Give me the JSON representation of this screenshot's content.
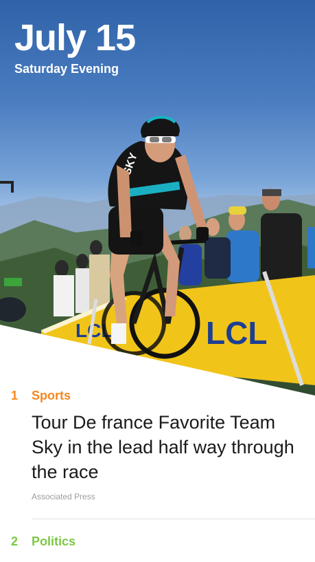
{
  "header": {
    "date": "July 15",
    "subtitle": "Saturday Evening"
  },
  "stories": [
    {
      "number": "1",
      "category": "Sports",
      "category_color": "#f4871f",
      "headline": "Tour De france Favorite Team Sky in the lead half way through the race",
      "source": "Associated Press"
    },
    {
      "number": "2",
      "category": "Politics",
      "category_color": "#7ac943"
    }
  ],
  "hero_image": {
    "banner_text": "LCL",
    "jersey_text": "SKY"
  }
}
